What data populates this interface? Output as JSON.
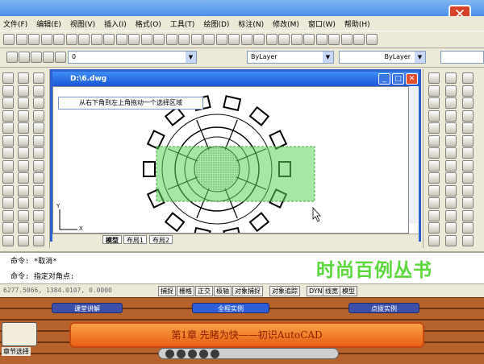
{
  "menu": [
    "文件(F)",
    "编辑(E)",
    "视图(V)",
    "插入(I)",
    "格式(O)",
    "工具(T)",
    "绘图(D)",
    "标注(N)",
    "修改(M)",
    "窗口(W)",
    "帮助(H)"
  ],
  "toolbar2": {
    "layer_value": "0",
    "color_value": "ByLayer",
    "linetype_value": "ByLayer"
  },
  "drawing": {
    "title": "D:\\6.dwg",
    "tooltip": "从右下角到左上角拖动一个选择区域",
    "tabs": [
      "模型",
      "布局1",
      "布局2"
    ],
    "axis_x": "X",
    "axis_y": "Y"
  },
  "command": {
    "line1": "命令: *取消*",
    "line2": "命令: 指定对角点:"
  },
  "watermark": "时尚百例丛书",
  "status": {
    "coords": "6277.5066, 1384.0107, 0.0000",
    "buttons": [
      "捕捉",
      "栅格",
      "正交",
      "极轴",
      "对象捕捉",
      "对象追踪",
      "DYN",
      "线宽",
      "模型"
    ]
  },
  "bottom": {
    "nav": [
      "课堂讲解",
      "全程实例",
      "点拨实例"
    ],
    "chapter_title": "第1章  先睹为快——初识AutoCAD",
    "chapter_select": "章节选择"
  }
}
